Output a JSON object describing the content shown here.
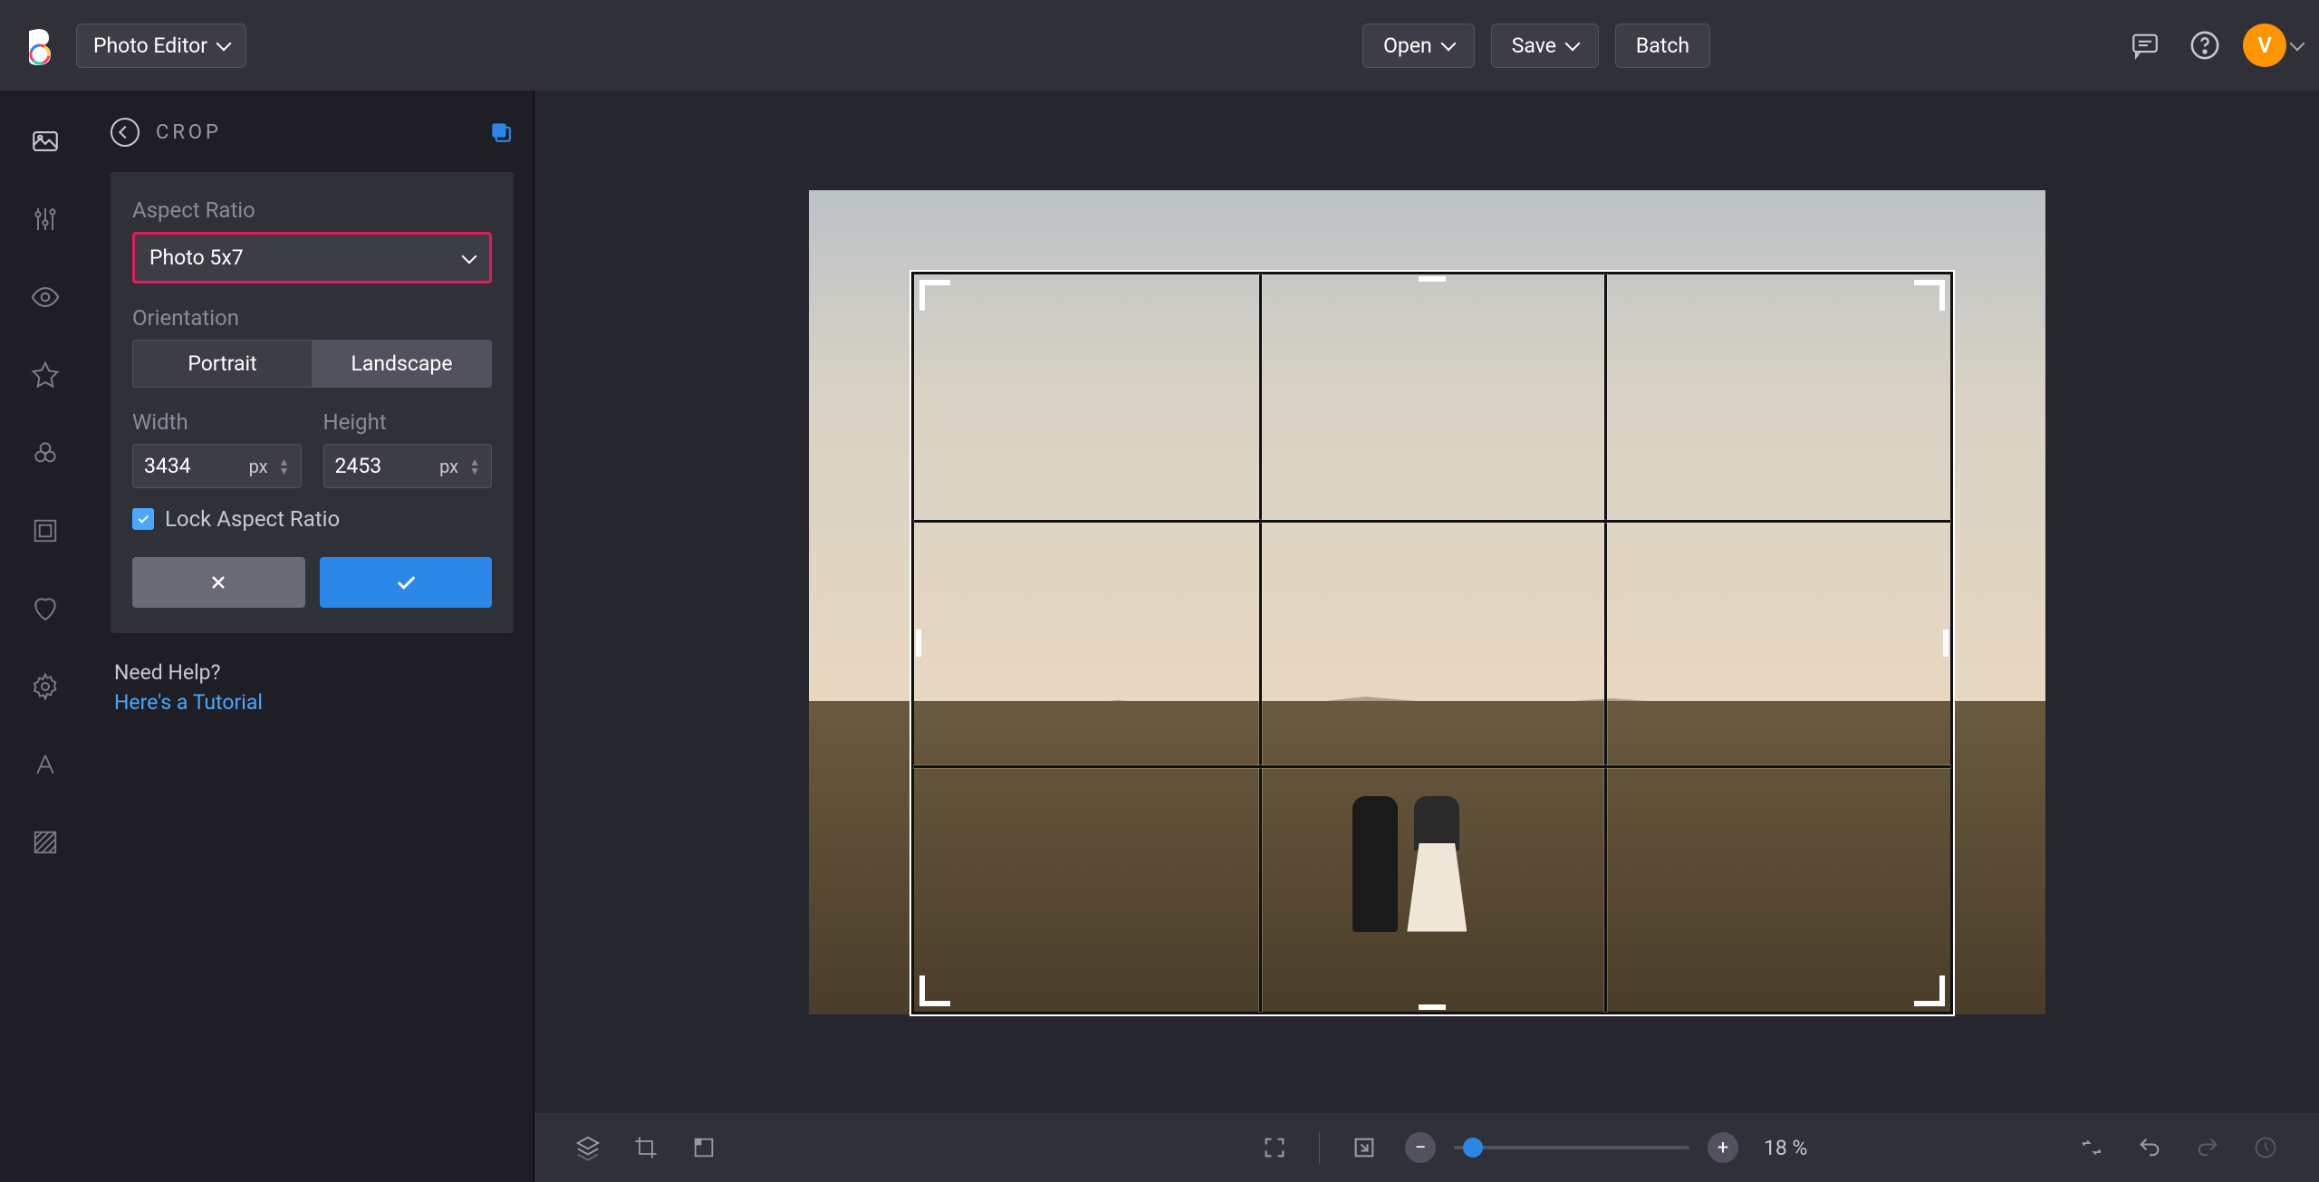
{
  "header": {
    "app_name": "Photo Editor",
    "open_label": "Open",
    "save_label": "Save",
    "batch_label": "Batch",
    "avatar_initial": "V"
  },
  "panel": {
    "title": "CROP",
    "aspect_ratio_label": "Aspect Ratio",
    "aspect_ratio_value": "Photo 5x7",
    "orientation_label": "Orientation",
    "orientation_portrait": "Portrait",
    "orientation_landscape": "Landscape",
    "orientation_selected": "Landscape",
    "width_label": "Width",
    "height_label": "Height",
    "width_value": "3434",
    "height_value": "2453",
    "unit": "px",
    "lock_label": "Lock Aspect Ratio",
    "lock_checked": true,
    "help_q": "Need Help?",
    "help_link": "Here's a Tutorial"
  },
  "footer": {
    "zoom_pct": "18 %"
  }
}
